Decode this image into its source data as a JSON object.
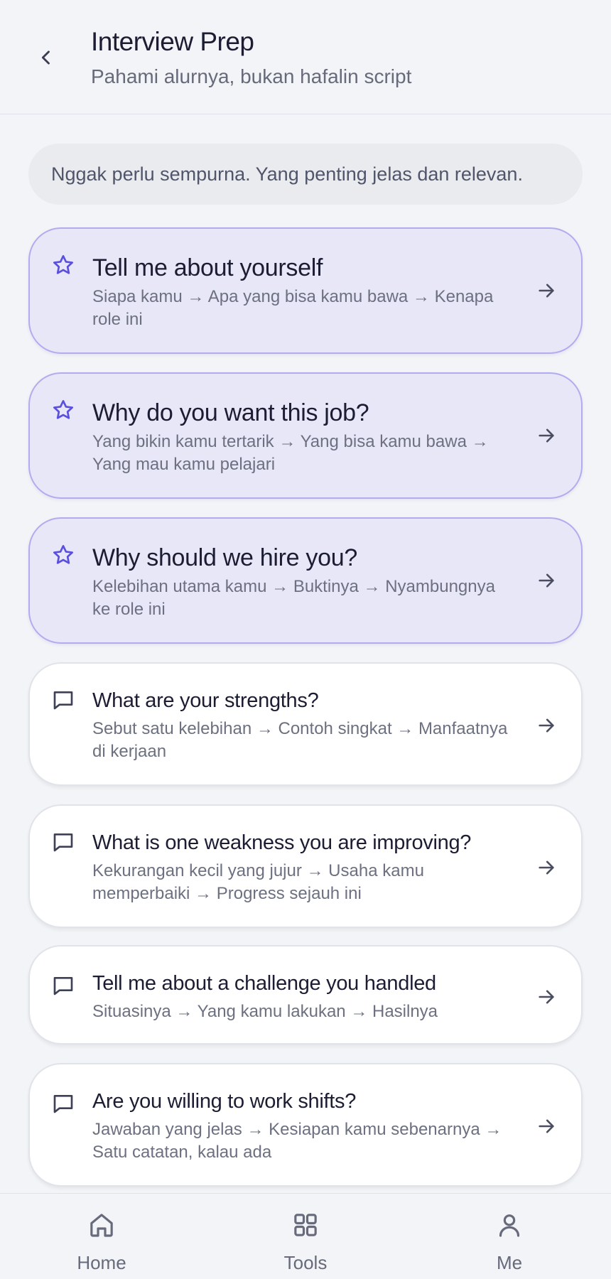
{
  "header": {
    "title": "Interview Prep",
    "subtitle": "Pahami alurnya, bukan hafalin script",
    "back_icon": "chevron-left-icon"
  },
  "tip": "Nggak perlu sempurna. Yang penting jelas dan relevan.",
  "colors": {
    "accent": "#5b4fe0",
    "featured_bg": "#e7e7f8",
    "featured_border": "#b2acef",
    "page_bg": "#f2f4f7"
  },
  "questions": [
    {
      "title": "Tell me about yourself",
      "desc": "Siapa kamu → Apa yang bisa kamu bawa → Kenapa role ini",
      "featured": true,
      "icon": "star-icon"
    },
    {
      "title": "Why do you want this job?",
      "desc": "Yang bikin kamu tertarik → Yang bisa kamu bawa → Yang mau kamu pelajari",
      "featured": true,
      "icon": "star-icon"
    },
    {
      "title": "Why should we hire you?",
      "desc": "Kelebihan utama kamu → Buktinya → Nyambungnya ke role ini",
      "featured": true,
      "icon": "star-icon"
    },
    {
      "title": "What are your strengths?",
      "desc": "Sebut satu kelebihan → Contoh singkat → Manfaatnya di kerjaan",
      "featured": false,
      "icon": "chat-bubble-icon"
    },
    {
      "title": "What is one weakness you are improving?",
      "desc": "Kekurangan kecil yang jujur → Usaha kamu memperbaiki → Progress sejauh ini",
      "featured": false,
      "icon": "chat-bubble-icon"
    },
    {
      "title": "Tell me about a challenge you handled",
      "desc": "Situasinya → Yang kamu lakukan → Hasilnya",
      "featured": false,
      "icon": "chat-bubble-icon"
    },
    {
      "title": "Are you willing to work shifts?",
      "desc": "Jawaban yang jelas → Kesiapan kamu sebenarnya → Satu catatan, kalau ada",
      "featured": false,
      "icon": "chat-bubble-icon"
    }
  ],
  "nav": [
    {
      "label": "Home",
      "icon": "home-icon"
    },
    {
      "label": "Tools",
      "icon": "grid-icon"
    },
    {
      "label": "Me",
      "icon": "user-icon"
    }
  ]
}
